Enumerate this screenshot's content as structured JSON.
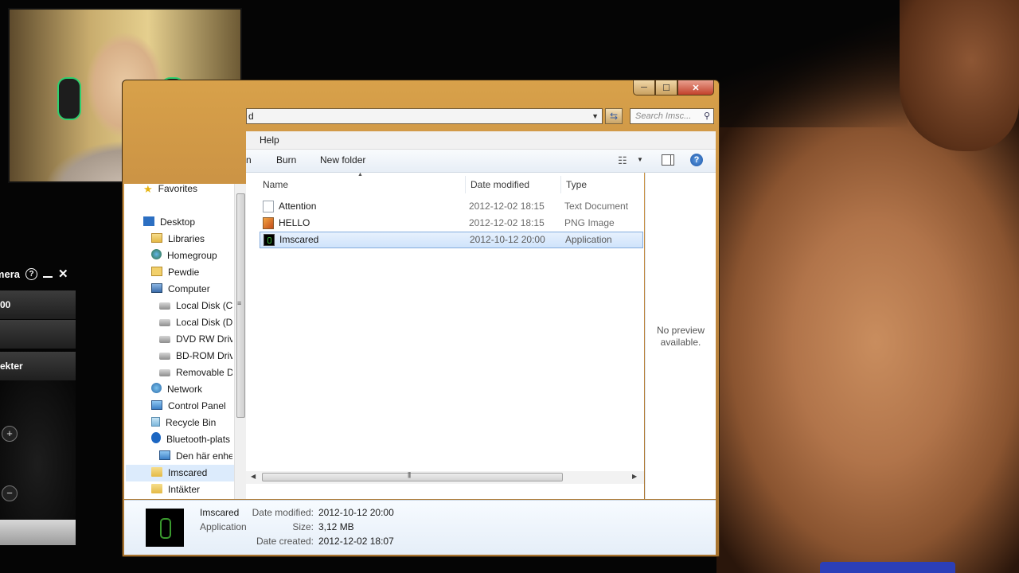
{
  "window": {
    "controls": {
      "minimize": "─",
      "maximize": "☐",
      "close": "✕"
    },
    "address_text": "d",
    "search_placeholder": "Search Imsc..."
  },
  "menu": {
    "help": "Help"
  },
  "toolbar": {
    "burn": "Burn",
    "new_folder": "New folder",
    "partial_left": "n"
  },
  "columns": {
    "name": "Name",
    "date_modified": "Date modified",
    "type": "Type"
  },
  "files": [
    {
      "name": "Attention",
      "date": "2012-12-02 18:15",
      "type": "Text Document",
      "icon": "text-file-icon"
    },
    {
      "name": "HELLO",
      "date": "2012-12-02 18:15",
      "type": "PNG Image",
      "icon": "image-file-icon"
    },
    {
      "name": "Imscared",
      "date": "2012-10-12 20:00",
      "type": "Application",
      "icon": "application-icon",
      "selected": true
    }
  ],
  "nav": {
    "favorites": "Favorites",
    "items": [
      {
        "label": "Desktop",
        "icon": "desktop-icon"
      },
      {
        "label": "Libraries",
        "icon": "libraries-icon"
      },
      {
        "label": "Homegroup",
        "icon": "homegroup-icon"
      },
      {
        "label": "Pewdie",
        "icon": "user-folder-icon"
      },
      {
        "label": "Computer",
        "icon": "computer-icon"
      },
      {
        "label": "Local Disk (C:",
        "icon": "disk-icon"
      },
      {
        "label": "Local Disk (D:",
        "icon": "disk-icon"
      },
      {
        "label": "DVD RW Drive",
        "icon": "dvd-drive-icon"
      },
      {
        "label": "BD-ROM Driv",
        "icon": "bd-drive-icon"
      },
      {
        "label": "Removable Di",
        "icon": "removable-disk-icon"
      },
      {
        "label": "Network",
        "icon": "network-icon"
      },
      {
        "label": "Control Panel",
        "icon": "control-panel-icon"
      },
      {
        "label": "Recycle Bin",
        "icon": "recycle-bin-icon"
      },
      {
        "label": "Bluetooth-plats",
        "icon": "bluetooth-icon"
      },
      {
        "label": "Den här enhet",
        "icon": "device-icon"
      },
      {
        "label": "Imscared",
        "icon": "folder-icon",
        "selected": true
      },
      {
        "label": "Intäkter",
        "icon": "folder-icon"
      }
    ]
  },
  "preview": {
    "message_line1": "No preview",
    "message_line2": "available."
  },
  "details": {
    "name": "Imscared",
    "type": "Application",
    "date_modified_label": "Date modified:",
    "date_modified": "2012-10-12 20:00",
    "size_label": "Size:",
    "size": "3,12 MB",
    "date_created_label": "Date created:",
    "date_created": "2012-12-02 18:07"
  },
  "camera_widget": {
    "title": "mera",
    "row1": "00",
    "row2": "ekter"
  }
}
